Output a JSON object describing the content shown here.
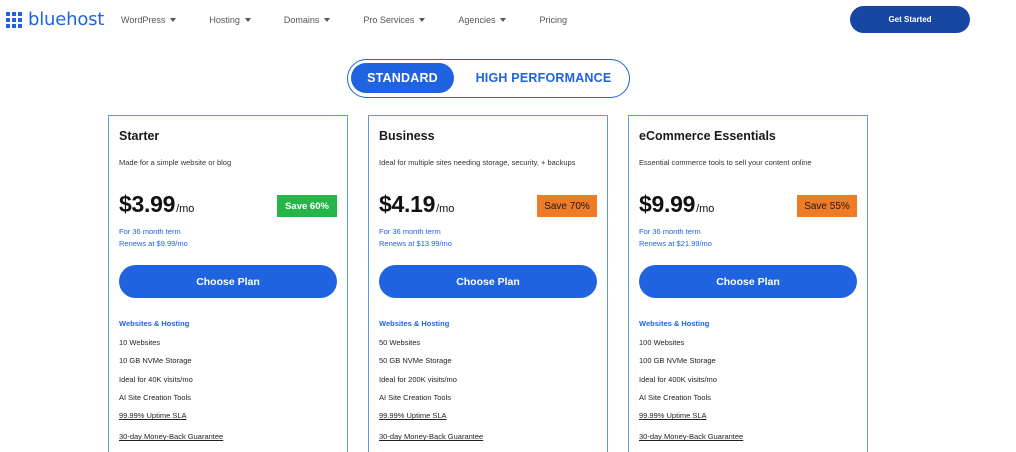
{
  "brand": {
    "name": "bluehost",
    "color": "#1f63e0"
  },
  "nav": {
    "items": [
      {
        "label": "WordPress",
        "dropdown": true
      },
      {
        "label": "Hosting",
        "dropdown": true
      },
      {
        "label": "Domains",
        "dropdown": true
      },
      {
        "label": "Pro Services",
        "dropdown": true
      },
      {
        "label": "Agencies",
        "dropdown": true
      },
      {
        "label": "Pricing",
        "dropdown": false
      }
    ],
    "cta": "Get Started"
  },
  "plan_toggle": {
    "active": "STANDARD",
    "inactive": "HIGH PERFORMANCE"
  },
  "plans": [
    {
      "name": "Starter",
      "description": "Made for a simple website or blog",
      "price": "$3.99",
      "per": "/mo",
      "save": "Save 60%",
      "save_color": "#27b54a",
      "term": "For 36 month term",
      "renews": "Renews at $9.99/mo",
      "cta": "Choose Plan",
      "features_heading": "Websites & Hosting",
      "features": [
        "10 Websites",
        "10 GB NVMe Storage",
        "Ideal for 40K visits/mo",
        "AI Site Creation Tools",
        "99.99% Uptime SLA",
        "30-day Money-Back Guarantee"
      ]
    },
    {
      "name": "Business",
      "description": "Ideal for multiple sites needing storage, security, + backups",
      "price": "$4.19",
      "per": "/mo",
      "save": "Save 70%",
      "save_color": "#f07b27",
      "term": "For 36 month term",
      "renews": "Renews at $13.99/mo",
      "cta": "Choose Plan",
      "features_heading": "Websites & Hosting",
      "features": [
        "50 Websites",
        "50 GB NVMe Storage",
        "Ideal for 200K visits/mo",
        "AI Site Creation Tools",
        "99.99% Uptime SLA",
        "30-day Money-Back Guarantee"
      ]
    },
    {
      "name": "eCommerce Essentials",
      "description": "Essential commerce tools to sell your content online",
      "price": "$9.99",
      "per": "/mo",
      "save": "Save 55%",
      "save_color": "#f07b27",
      "term": "For 36 month term",
      "renews": "Renews at $21.99/mo",
      "cta": "Choose Plan",
      "features_heading": "Websites & Hosting",
      "features": [
        "100 Websites",
        "100 GB NVMe Storage",
        "Ideal for 400K visits/mo",
        "AI Site Creation Tools",
        "99.99% Uptime SLA",
        "30-day Money-Back Guarantee"
      ]
    }
  ]
}
